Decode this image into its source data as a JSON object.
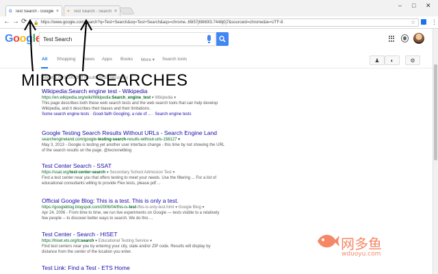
{
  "browser": {
    "tabs": [
      {
        "title": "Test Search - Google Se",
        "favicon": "G",
        "active": true
      },
      {
        "title": "Test Search - Search Re",
        "favicon": "♥",
        "active": false
      }
    ],
    "url": "https://www.google.com/search?q=Test+Search&oq=Test+Search&aqs=chrome..69i57j69i60l3.7448j0j7&sourceid=chrome&ie=UTF-8",
    "window_controls": [
      "–",
      "□",
      "✕"
    ],
    "nav": {
      "back": "←",
      "forward": "→",
      "reload": "⟳"
    }
  },
  "google": {
    "logo": [
      "G",
      "o",
      "o",
      "g",
      "l",
      "e"
    ],
    "query": "Test Search",
    "tabs": [
      "All",
      "Shopping",
      "News",
      "Apps",
      "Books",
      "More ▾",
      "Search tools"
    ],
    "stats": "About 1,000,000,000 results (0.55 seconds)"
  },
  "annotation": {
    "label": "MIRROR SEARCHES"
  },
  "results": [
    {
      "title": "Wikipedia:Search engine test - Wikipedia",
      "url": "https://en.wikipedia.org/wiki/Wikipedia:",
      "url_bold": "Search_engine_test",
      "url_tail": " ▾ Wikipedia ▾",
      "snippet": "This page describes both these web search tests and the web search tools that can help develop Wikipedia, and it describes their biases and their limitations.",
      "sitelinks": "Some search engine tests · Good-faith Googling, a rule of ... · Search engine tests"
    },
    {
      "title": "Google Testing Search Results Without URLs - Search Engine Land",
      "url": "searchengineland.com/google-",
      "url_bold": "testing-search",
      "url_tail": "-results-without-urls-158127 ▾",
      "snippet": "May 3, 2013 - Google is testing yet another user interface change - this time by not showing the URL of the search results on the page. @tecnonetblog"
    },
    {
      "title": "Test Center Search - SSAT",
      "url": "https://ssat.org/",
      "url_bold": "test-center-search",
      "url_tail": " ▾ Secondary School Admission Test ▾",
      "snippet": "Find a test center near you that offers testing to meet your needs. Use the filtering ... For a list of educational consultants willing to provide Flex tests, please pdf ..."
    },
    {
      "title": "Official Google Blog: This is a test. This is only a test.",
      "url": "https://googleblog.blogspot.com/2006/04/this-is-",
      "url_bold": "test",
      "url_tail": "-this-is-only-test.html ▾ Google Blog ▾",
      "snippet": "Apr 24, 2006 - From time to time, we run live experiments on Google — tests visible to a relatively few people -- to discover better ways to search. We do this ..."
    },
    {
      "title": "Test Center - Search - HISET",
      "url": "https://hiset.ets.org/tc",
      "url_bold": "search",
      "url_tail": " ▾ Educational Testing Service ▾",
      "snippet": "Find test centers near you by entering your city, state and/or ZIP code. Results will display by distance from the center of the location you enter."
    },
    {
      "title": "Test Link: Find a Test - ETS Home"
    }
  ],
  "watermark": {
    "name": "网多鱼",
    "url": "wduoyu.com"
  }
}
